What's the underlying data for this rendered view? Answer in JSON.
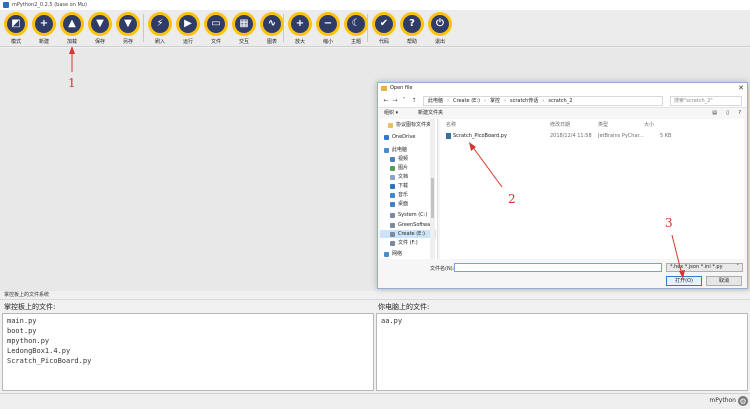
{
  "window": {
    "title": "mPython2_0.2.5 (base on Mu)"
  },
  "toolbar": {
    "buttons": [
      {
        "label": "模式",
        "glyph": "◩"
      },
      {
        "label": "新建",
        "glyph": "+"
      },
      {
        "label": "加载",
        "glyph": "▲"
      },
      {
        "label": "保存",
        "glyph": "▼"
      },
      {
        "label": "另存",
        "glyph": "▼"
      },
      {
        "label": "刷入",
        "glyph": "⚡"
      },
      {
        "label": "运行",
        "glyph": "▶"
      },
      {
        "label": "文件",
        "glyph": "▭"
      },
      {
        "label": "交互",
        "glyph": "▦"
      },
      {
        "label": "图表",
        "glyph": "∿"
      },
      {
        "label": "放大",
        "glyph": "+"
      },
      {
        "label": "缩小",
        "glyph": "−"
      },
      {
        "label": "主题",
        "glyph": "☾"
      },
      {
        "label": "代码",
        "glyph": "✔"
      },
      {
        "label": "帮助",
        "glyph": "?"
      },
      {
        "label": "退出",
        "glyph": "⏻"
      }
    ]
  },
  "files_panel": {
    "header": "掌控板上的文件系统",
    "board_label": "掌控板上的文件:",
    "board_files": [
      "main.py",
      "boot.py",
      "mpython.py",
      "LedongBox1.4.py",
      "Scratch_PicoBoard.py"
    ],
    "pc_label": "你电脑上的文件:",
    "pc_files": [
      "aa.py"
    ]
  },
  "statusbar": {
    "mode": "mPython"
  },
  "dialog": {
    "title": "Open file",
    "close": "✕",
    "breadcrumb": [
      "此电脑",
      "Create (E:)",
      "掌控",
      "scratch传话",
      "scratch_2"
    ],
    "search_placeholder": "搜索\"scratch_2\"",
    "toolbar": {
      "organize": "组织 ▾",
      "new_folder": "新建文件夹"
    },
    "tree": [
      {
        "label": "协议图标文件夹",
        "icon": "folder-icon",
        "color": "#e8c060"
      },
      {
        "label": "OneDrive",
        "icon": "cloud-icon",
        "color": "#2c7ad6"
      },
      {
        "label": "此电脑",
        "icon": "computer-icon",
        "color": "#4a8ec9"
      },
      {
        "label": "视频",
        "icon": "video-icon",
        "color": "#4a7fc0"
      },
      {
        "label": "图片",
        "icon": "picture-icon",
        "color": "#5a9a5a"
      },
      {
        "label": "文档",
        "icon": "document-icon",
        "color": "#8aa2c6"
      },
      {
        "label": "下载",
        "icon": "download-icon",
        "color": "#2b73c9"
      },
      {
        "label": "音乐",
        "icon": "music-icon",
        "color": "#3d88d4"
      },
      {
        "label": "桌面",
        "icon": "desktop-icon",
        "color": "#3f7fc8"
      },
      {
        "label": "System (C:)",
        "icon": "drive-icon",
        "color": "#7b8aa0"
      },
      {
        "label": "GreenSoftware",
        "icon": "drive-icon",
        "color": "#7b8aa0"
      },
      {
        "label": "Create (E:)",
        "icon": "drive-icon",
        "color": "#7b8aa0",
        "selected": true
      },
      {
        "label": "文件 (F:)",
        "icon": "drive-icon",
        "color": "#7b8aa0"
      },
      {
        "label": "网络",
        "icon": "network-icon",
        "color": "#4a8ec9"
      }
    ],
    "columns": {
      "name": "名称",
      "date": "修改日期",
      "type": "类型",
      "size": "大小"
    },
    "files": [
      {
        "name": "Scratch_PicoBoard.py",
        "date": "2018/12/4 11:58",
        "type": "JetBrains PyChar...",
        "size": "5 KB"
      }
    ],
    "filename_label": "文件名(N):",
    "filter": "*.hex *.json *.ini *.py",
    "open_button": "打开(O)",
    "cancel_button": "取消"
  },
  "annotations": {
    "step1": "1",
    "step2": "2",
    "step3": "3",
    "color": "#d6362c"
  }
}
